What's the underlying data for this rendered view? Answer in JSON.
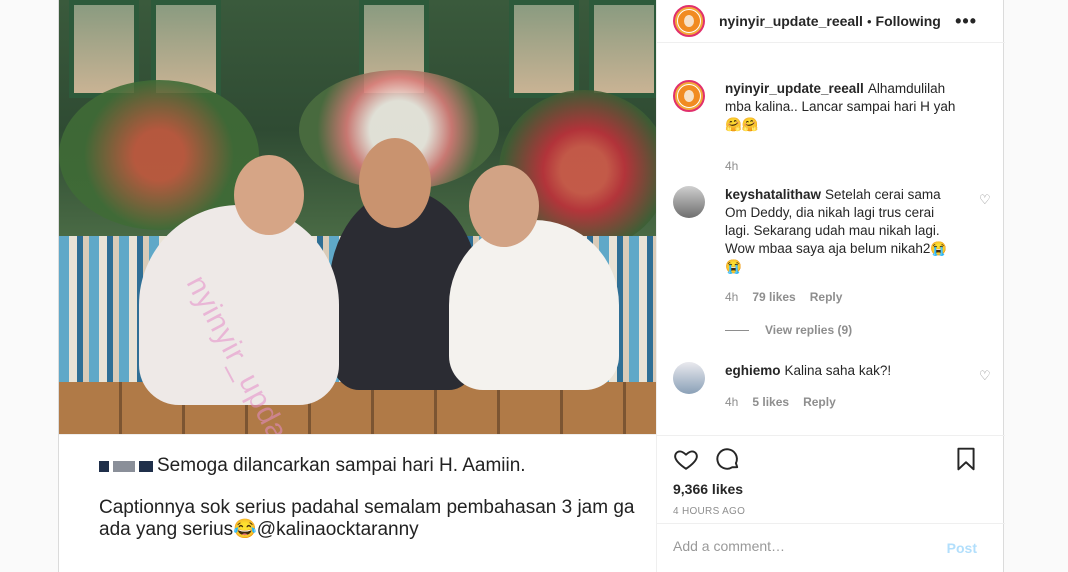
{
  "header": {
    "username": "nyinyir_update_reeall",
    "separator": "•",
    "follow_status": "Following",
    "more_icon": "more-horizontal-icon"
  },
  "post_image": {
    "watermark": "nyinyir_update_reeall",
    "caption_line1": "Semoga dilancarkan sampai hari H. Aamiin.",
    "caption_line2": "Captionnya sok serius padahal semalam pembahasan 3 jam ga ada yang serius😂@kalinaocktaranny"
  },
  "comments": [
    {
      "username": "nyinyir_update_reeall",
      "text": "Alhamdulilah mba kalina.. Lancar sampai hari H yah🤗🤗",
      "time": "4h"
    },
    {
      "username": "keyshatalithaw",
      "text": "Setelah cerai sama Om Deddy, dia nikah lagi trus cerai lagi. Sekarang udah mau nikah lagi. Wow mbaa saya aja belum nikah2😭😭",
      "time": "4h",
      "likes": "79 likes",
      "reply": "Reply",
      "view_replies": "View replies (9)"
    },
    {
      "username": "eghiemo",
      "text": "Kalina saha kak?!",
      "time": "4h",
      "likes": "5 likes",
      "reply": "Reply"
    }
  ],
  "actions": {
    "like_icon": "heart-icon",
    "comment_icon": "comment-bubble-icon",
    "save_icon": "bookmark-icon",
    "likes_count": "9,366 likes",
    "posted_time": "4 HOURS AGO"
  },
  "add_comment": {
    "placeholder": "Add a comment…",
    "post_label": "Post"
  },
  "colors": {
    "story_ring": "#e1306c",
    "post_disabled": "#b2dffc",
    "muted": "#8e8e8e"
  }
}
